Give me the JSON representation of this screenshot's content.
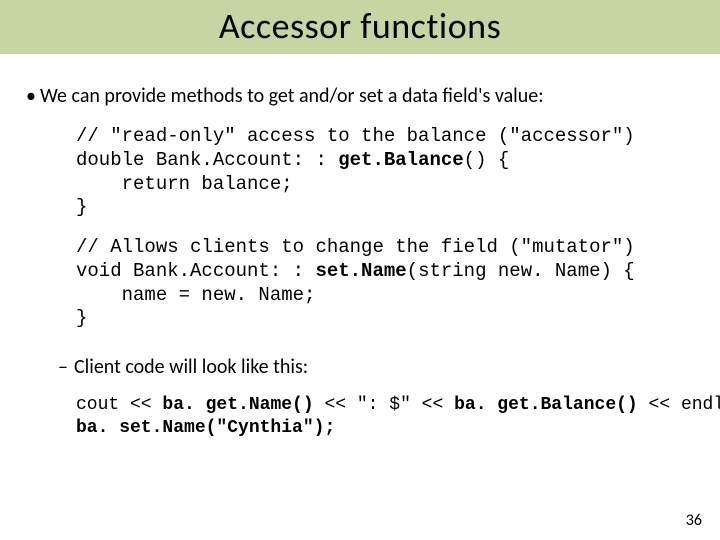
{
  "title": "Accessor functions",
  "bullet": "We can provide methods to get and/or set a data field's value:",
  "code1_comment": "// \"read-only\" access to the balance (\"accessor\")",
  "code1_sig_a": "double Bank.Account: : ",
  "code1_sig_b": "get.Balance",
  "code1_sig_c": "() {",
  "code1_ret": "    return balance;",
  "code1_close": "}",
  "code2_comment": "// Allows clients to change the field (\"mutator\")",
  "code2_sig_a": "void Bank.Account: : ",
  "code2_sig_b": "set.Name",
  "code2_sig_c": "(string new. Name) {",
  "code2_assn": "    name = new. Name;",
  "code2_close": "}",
  "dash": "Client code will look like this:",
  "cc_a": "cout << ",
  "cc_b": "ba. get.Name()",
  "cc_c": " << \": $\" << ",
  "cc_d": "ba. get.Balance()",
  "cc_e": " << endl;",
  "cc2": "ba. set.Name(\"Cynthia\");",
  "page": "36"
}
